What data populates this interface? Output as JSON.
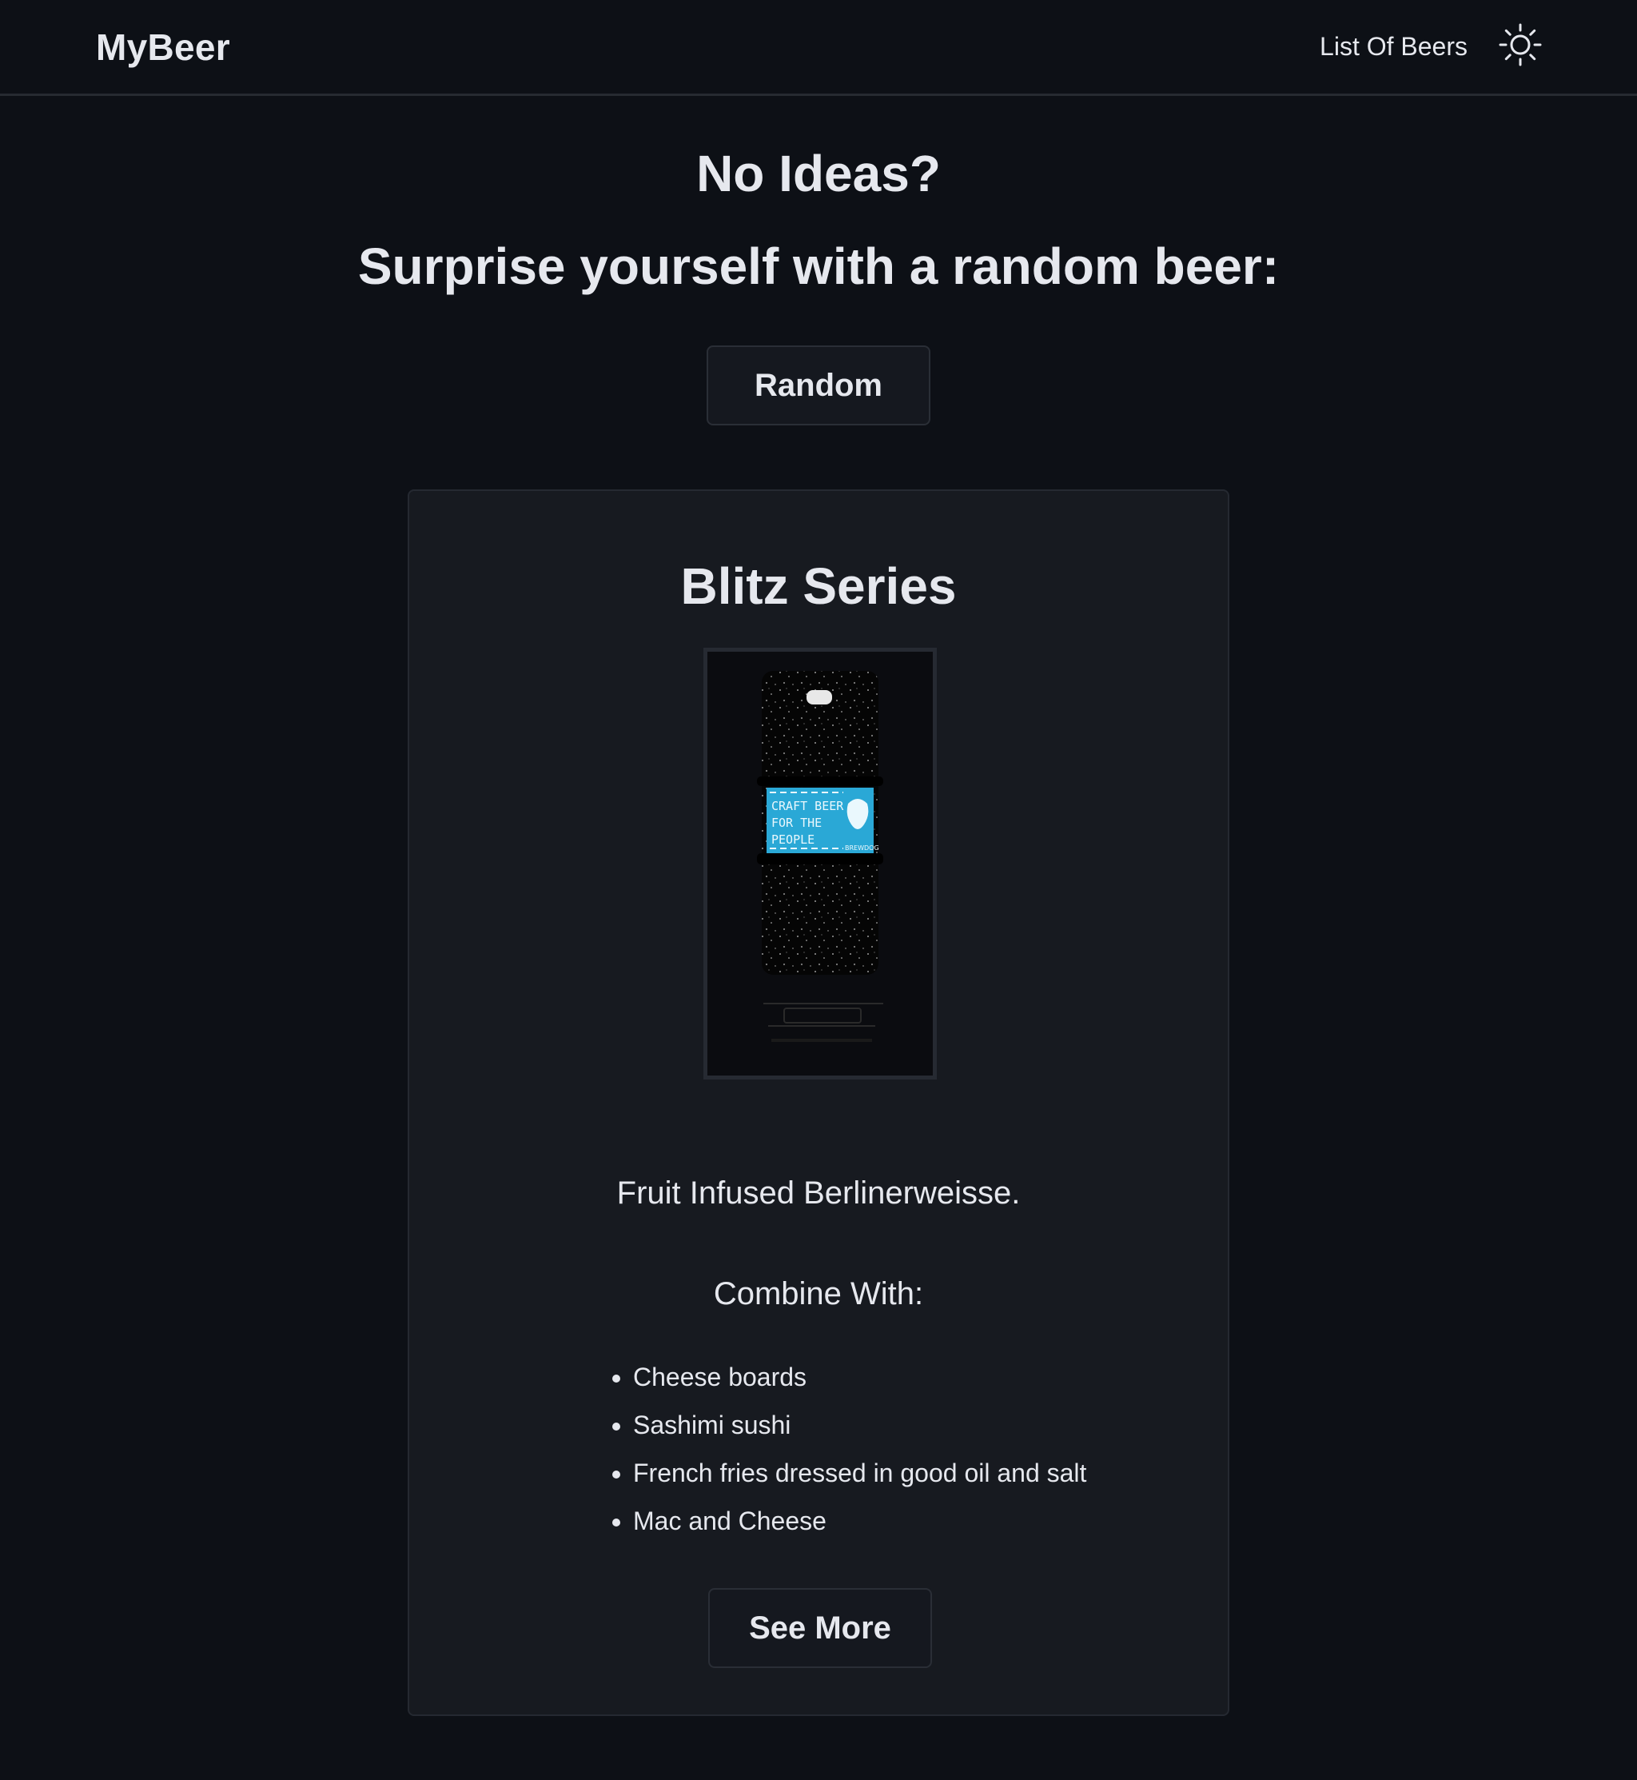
{
  "header": {
    "brand": "MyBeer",
    "nav_link": "List Of Beers",
    "theme_icon": "sun-icon"
  },
  "hero": {
    "title": "No Ideas?",
    "subtitle": "Surprise yourself with a random beer:",
    "random_button": "Random"
  },
  "beer_card": {
    "name": "Blitz Series",
    "image_icon": "beer-can-image",
    "label_text": [
      "CRAFT BEER",
      "FOR THE",
      "PEOPLE"
    ],
    "brand_mark": "BREWDOG",
    "tagline": "Fruit Infused Berlinerweisse.",
    "combine_label": "Combine With:",
    "food_pairings": [
      "Cheese boards",
      "Sashimi sushi",
      "French fries dressed in good oil and salt",
      "Mac and Cheese"
    ],
    "see_more_button": "See More"
  },
  "colors": {
    "background": "#0d1016",
    "card": "#171a20",
    "text": "#e6e8ee",
    "border": "#262a31",
    "label_blue": "#2aa8d6"
  }
}
